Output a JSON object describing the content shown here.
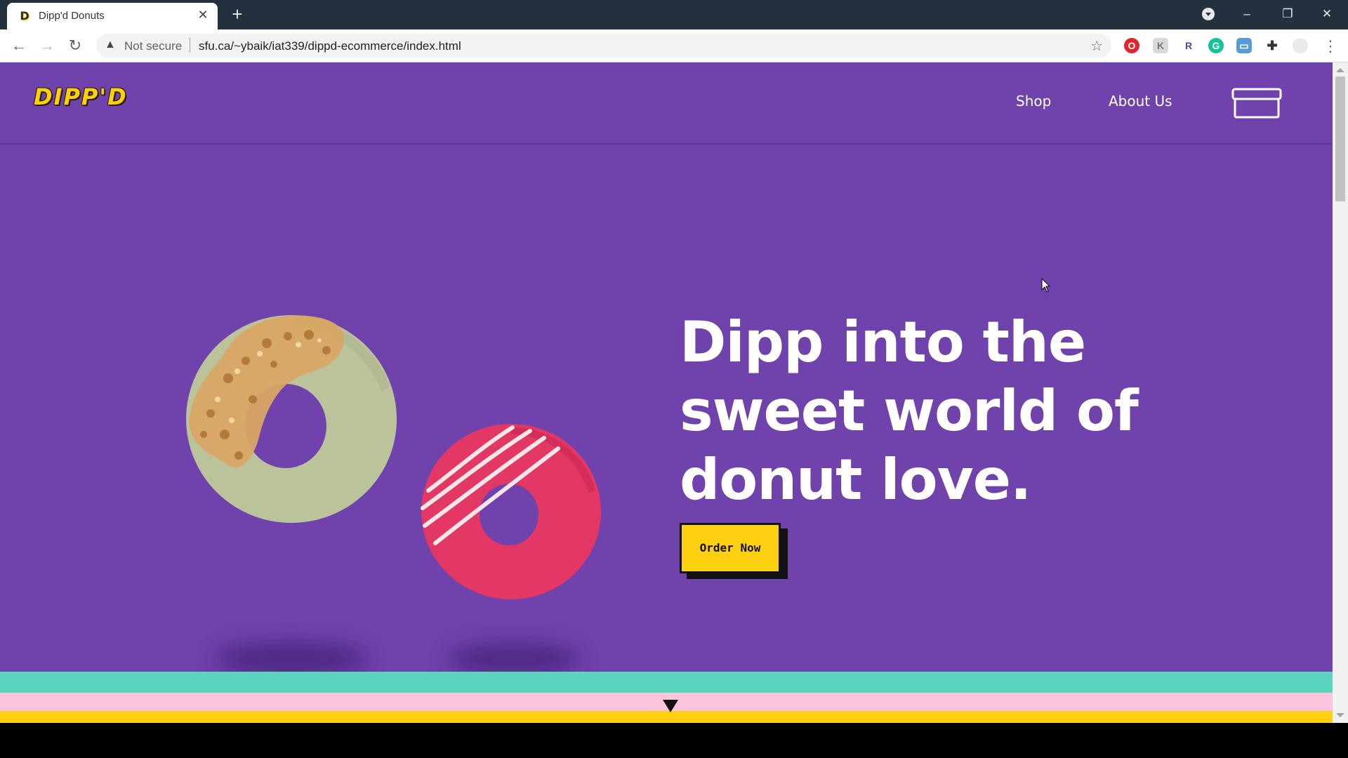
{
  "browser": {
    "tab_title": "Dipp'd Donuts",
    "favicon_letter": "D",
    "close_tab": "✕",
    "new_tab": "+",
    "security_label": "Not secure",
    "url": "sfu.ca/~ybaik/iat339/dippd-ecommerce/index.html",
    "window_controls": {
      "minimize": "–",
      "restore": "❐",
      "close": "✕"
    },
    "nav": {
      "back": "←",
      "forward": "→",
      "reload": "↻"
    },
    "extensions": [
      "opera-icon",
      "k-extension-icon",
      "r-extension-icon",
      "grammarly-icon",
      "screen-capture-icon",
      "puzzle-icon",
      "profile-icon"
    ]
  },
  "site": {
    "logo": "DIPP'D",
    "nav": {
      "shop": "Shop",
      "about": "About Us"
    },
    "hero": {
      "title": "Dipp into the sweet world of donut love.",
      "cta": "Order Now"
    },
    "colors": {
      "background": "#7042ab",
      "accent_yellow": "#ffd010",
      "stripe_teal": "#5ad6c0",
      "stripe_pink": "#fbc3dc"
    }
  }
}
